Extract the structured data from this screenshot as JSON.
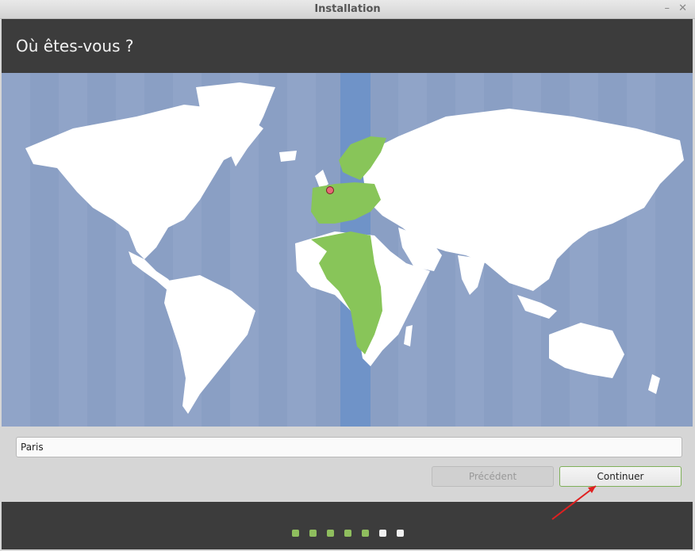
{
  "window": {
    "title": "Installation",
    "minimize_glyph": "–",
    "close_glyph": "✕"
  },
  "header": {
    "heading": "Où êtes-vous ?"
  },
  "map": {
    "ocean_color": "#8a9fc4",
    "land_color": "#ffffff",
    "selected_zone_color": "#6f93c8",
    "selected_region_color": "#88c559",
    "marker_color": "#e46b75"
  },
  "location": {
    "city_value": "Paris"
  },
  "buttons": {
    "previous_label": "Précédent",
    "continue_label": "Continuer"
  },
  "progress": {
    "steps_done": 5,
    "steps_total": 7,
    "done_color": "#8fbe5e",
    "todo_color": "#f1f1f1"
  },
  "annotation": {
    "arrow_color": "#e02020"
  }
}
